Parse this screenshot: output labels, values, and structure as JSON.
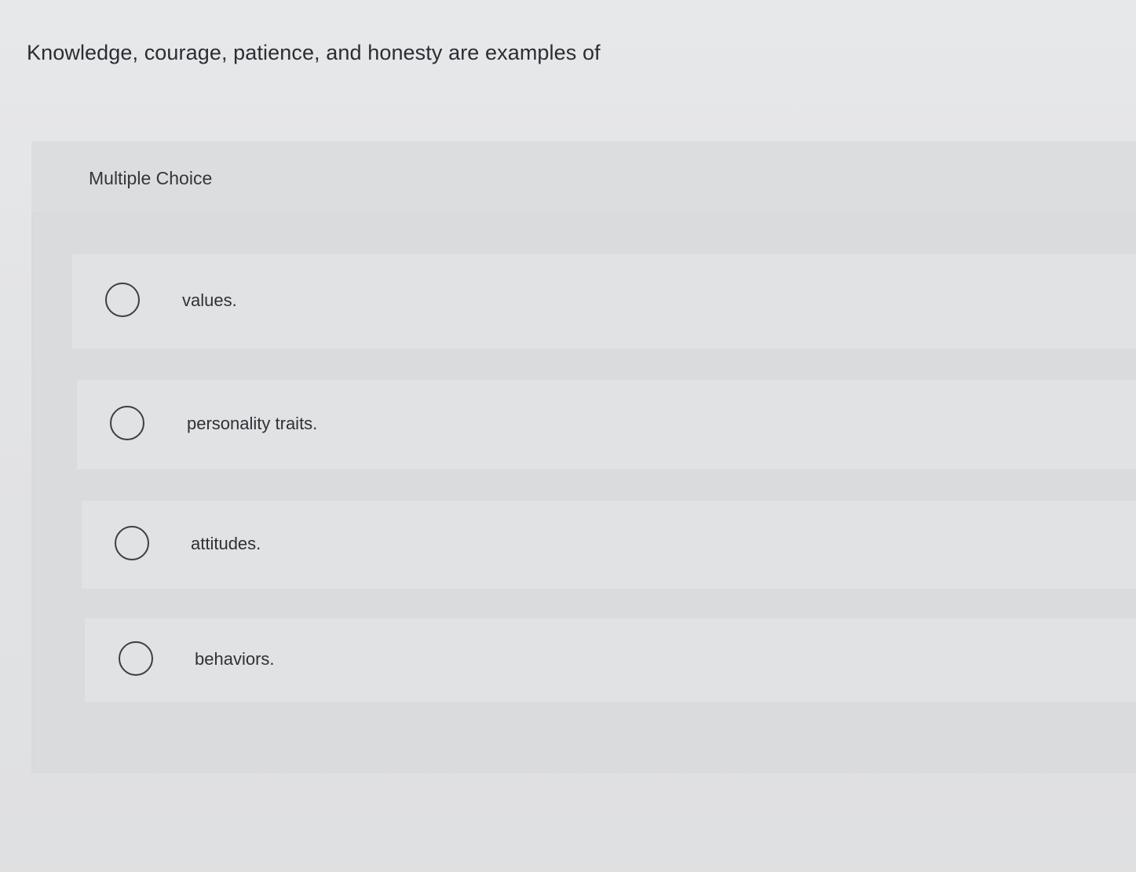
{
  "question": {
    "text": "Knowledge, courage, patience, and honesty are examples of"
  },
  "panel": {
    "header_label": "Multiple Choice"
  },
  "options": [
    {
      "label": "values.",
      "selected": false
    },
    {
      "label": "personality traits.",
      "selected": false
    },
    {
      "label": "attitudes.",
      "selected": false
    },
    {
      "label": "behaviors.",
      "selected": false
    }
  ]
}
